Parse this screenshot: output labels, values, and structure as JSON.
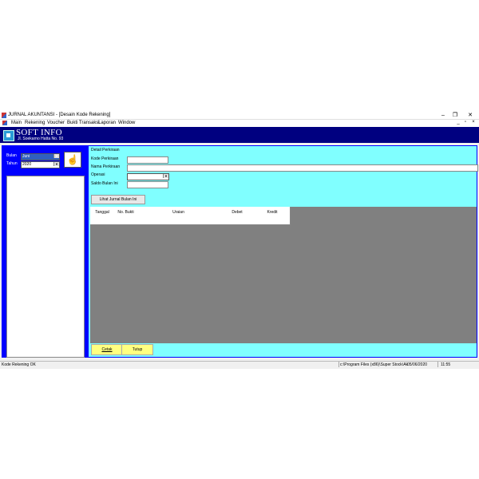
{
  "window": {
    "title": "JURNAL AKUNTANSI - [Desain Kode Rekening]",
    "controls": {
      "minimize": "–",
      "restore": "❐",
      "close": "✕"
    },
    "mdi_controls": {
      "minimize": "_",
      "restore": "▫",
      "close": "×"
    }
  },
  "menu": {
    "items": [
      "Main",
      "Rekening",
      "Voucher",
      "Bukti Transaksi",
      "Laporan",
      "Window"
    ]
  },
  "banner": {
    "brand": "SOFT INFO",
    "address": "Jl. Soekarno Hatta No. 93"
  },
  "left": {
    "bulan_label": "Bulan",
    "bulan_value": "Juni",
    "tahun_label": "Tahun",
    "tahun_value": "2020",
    "icon": "hand-pointer-icon"
  },
  "main": {
    "section_label": "Detail Perkiraan",
    "kode_label": "Kode Perkiraan",
    "kode_value": "",
    "nama_label": "Nama Perkiraan",
    "nama_value": "",
    "operasi_label": "Operasi",
    "operasi_value": "",
    "saldo_label": "Saldo Bulan Ini",
    "saldo_value": "",
    "lihat_button": "Lihat Jurnal Bulan Ini",
    "columns": [
      "Tanggal",
      "No. Bukti",
      "Uraian",
      "Debet",
      "Kredit"
    ],
    "cetak_button": "Cetak",
    "tutup_button": "Tutup"
  },
  "status": {
    "left": "Kode Rekening OK",
    "path": "c:\\Program Files (x86)\\Super Stock\\Ak",
    "date": "05/06/2020",
    "time": "11:55"
  }
}
